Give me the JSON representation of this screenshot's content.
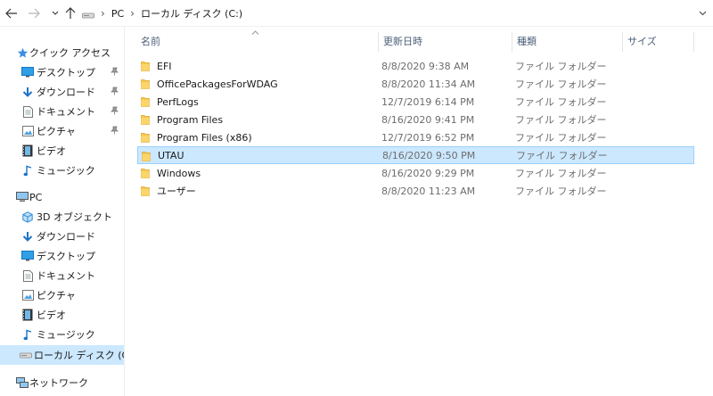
{
  "address": {
    "crumbs": [
      "PC",
      "ローカル ディスク (C:)"
    ]
  },
  "icons": {
    "back": "back-arrow-icon",
    "forward": "forward-arrow-icon",
    "recent": "chevron-down-icon",
    "up": "up-arrow-icon",
    "refresh": "chevron-down-icon"
  },
  "sidebar": {
    "quick_access": {
      "label": "クイック アクセス",
      "items": [
        {
          "label": "デスクトップ",
          "icon": "desktop-icon",
          "pinned": true
        },
        {
          "label": "ダウンロード",
          "icon": "download-icon",
          "pinned": true
        },
        {
          "label": "ドキュメント",
          "icon": "document-icon",
          "pinned": true
        },
        {
          "label": "ピクチャ",
          "icon": "pictures-icon",
          "pinned": true
        },
        {
          "label": "ビデオ",
          "icon": "video-icon",
          "pinned": false
        },
        {
          "label": "ミュージック",
          "icon": "music-icon",
          "pinned": false
        }
      ]
    },
    "pc": {
      "label": "PC",
      "items": [
        {
          "label": "3D オブジェクト",
          "icon": "3d-objects-icon"
        },
        {
          "label": "ダウンロード",
          "icon": "download-icon"
        },
        {
          "label": "デスクトップ",
          "icon": "desktop-icon"
        },
        {
          "label": "ドキュメント",
          "icon": "document-icon"
        },
        {
          "label": "ピクチャ",
          "icon": "pictures-icon"
        },
        {
          "label": "ビデオ",
          "icon": "video-icon"
        },
        {
          "label": "ミュージック",
          "icon": "music-icon"
        },
        {
          "label": "ローカル ディスク (C:)",
          "icon": "drive-icon",
          "selected": true
        }
      ]
    },
    "network": {
      "label": "ネットワーク",
      "icon": "network-icon"
    }
  },
  "columns": {
    "name": "名前",
    "date": "更新日時",
    "type": "種類",
    "size": "サイズ"
  },
  "files": [
    {
      "name": "EFI",
      "date": "8/8/2020 9:38 AM",
      "type": "ファイル フォルダー"
    },
    {
      "name": "OfficePackagesForWDAG",
      "date": "8/8/2020 11:34 AM",
      "type": "ファイル フォルダー"
    },
    {
      "name": "PerfLogs",
      "date": "12/7/2019 6:14 PM",
      "type": "ファイル フォルダー"
    },
    {
      "name": "Program Files",
      "date": "8/16/2020 9:41 PM",
      "type": "ファイル フォルダー"
    },
    {
      "name": "Program Files (x86)",
      "date": "12/7/2019 6:52 PM",
      "type": "ファイル フォルダー"
    },
    {
      "name": "UTAU",
      "date": "8/16/2020 9:50 PM",
      "type": "ファイル フォルダー",
      "selected": true
    },
    {
      "name": "Windows",
      "date": "8/16/2020 9:29 PM",
      "type": "ファイル フォルダー"
    },
    {
      "name": "ユーザー",
      "date": "8/8/2020 11:23 AM",
      "type": "ファイル フォルダー"
    }
  ],
  "colors": {
    "selection": "#cce8ff",
    "selection_border": "#99d1ff",
    "folder": "#f8c650",
    "accent": "#1e73c8"
  }
}
